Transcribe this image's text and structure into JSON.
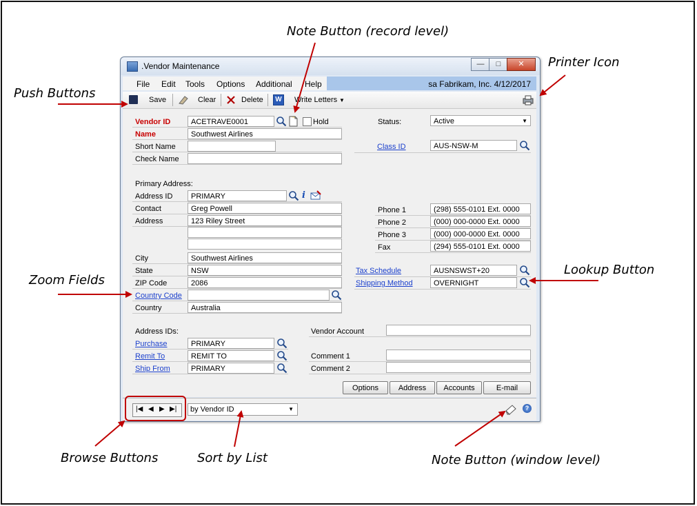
{
  "callouts": {
    "note_record": "Note Button (record level)",
    "printer_icon": "Printer Icon",
    "push_buttons": "Push Buttons",
    "zoom_fields": "Zoom Fields",
    "lookup_button": "Lookup Button",
    "browse_buttons": "Browse Buttons",
    "sort_by_list": "Sort by List",
    "note_window": "Note Button (window level)"
  },
  "window": {
    "title": ".Vendor Maintenance",
    "controls": {
      "minimize": "—",
      "maximize": "□",
      "close": "✕"
    }
  },
  "menu": [
    "File",
    "Edit",
    "Tools",
    "Options",
    "Additional",
    "Help"
  ],
  "user_info": "sa  Fabrikam, Inc.  4/12/2017",
  "toolbar": {
    "save": "Save",
    "clear": "Clear",
    "delete": "Delete",
    "write_letters": "Write Letters"
  },
  "form": {
    "vendor_id_label": "Vendor ID",
    "vendor_id": "ACETRAVE0001",
    "hold_label": "Hold",
    "name_label": "Name",
    "name": "Southwest Airlines",
    "short_name_label": "Short Name",
    "short_name": "",
    "check_name_label": "Check Name",
    "check_name": "",
    "status_label": "Status:",
    "status": "Active",
    "class_id_label": "Class ID",
    "class_id": "AUS-NSW-M",
    "primary_address_label": "Primary Address:",
    "address_id_label": "Address ID",
    "address_id": "PRIMARY",
    "contact_label": "Contact",
    "contact": "Greg Powell",
    "address_label": "Address",
    "address1": "123 Riley Street",
    "address2": "",
    "address3": "",
    "city_label": "City",
    "city": "Southwest Airlines",
    "state_label": "State",
    "state": "NSW",
    "zip_label": "ZIP Code",
    "zip": "2086",
    "country_code_label": "Country Code",
    "country_code": "",
    "country_label": "Country",
    "country": "Australia",
    "phone1_label": "Phone 1",
    "phone1": "(298) 555-0101  Ext. 0000",
    "phone2_label": "Phone 2",
    "phone2": "(000) 000-0000  Ext. 0000",
    "phone3_label": "Phone 3",
    "phone3": "(000) 000-0000  Ext. 0000",
    "fax_label": "Fax",
    "fax": "(294) 555-0101  Ext. 0000",
    "tax_schedule_label": "Tax Schedule",
    "tax_schedule": "AUSNSWST+20",
    "shipping_method_label": "Shipping Method",
    "shipping_method": "OVERNIGHT",
    "address_ids_label": "Address IDs:",
    "purchase_label": "Purchase",
    "purchase": "PRIMARY",
    "remit_to_label": "Remit To",
    "remit_to": "REMIT TO",
    "ship_from_label": "Ship From",
    "ship_from": "PRIMARY",
    "vendor_account_label": "Vendor Account",
    "vendor_account": "",
    "comment1_label": "Comment 1",
    "comment1": "",
    "comment2_label": "Comment 2",
    "comment2": ""
  },
  "buttons": {
    "options": "Options",
    "address": "Address",
    "accounts": "Accounts",
    "email": "E-mail"
  },
  "statusbar": {
    "browse": [
      "|◀",
      "◀",
      "▶",
      "▶|"
    ],
    "sort_by": "by Vendor ID"
  },
  "colors": {
    "required_label": "#c80000",
    "link": "#1a3fcc",
    "arrow": "#c00000",
    "user_info_bg": "#a9c6ea"
  }
}
